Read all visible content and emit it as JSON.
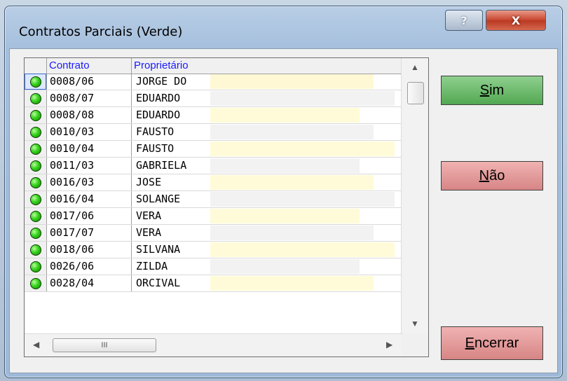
{
  "window": {
    "title": "Contratos Parciais (Verde)"
  },
  "titlebar": {
    "help_glyph": "?",
    "close_glyph": "X"
  },
  "grid": {
    "columns": [
      "",
      "Contrato",
      "Proprietário"
    ],
    "rows": [
      {
        "contrato": "0008/06",
        "proprietario": "JORGE DO",
        "highlight_color": "#fff8d4",
        "selected": true
      },
      {
        "contrato": "0008/07",
        "proprietario": "EDUARDO",
        "highlight_color": "#f2f2f2",
        "selected": false
      },
      {
        "contrato": "0008/08",
        "proprietario": "EDUARDO",
        "highlight_color": "#fffbd8",
        "selected": false
      },
      {
        "contrato": "0010/03",
        "proprietario": "FAUSTO",
        "highlight_color": "#f2f2f2",
        "selected": false
      },
      {
        "contrato": "0010/04",
        "proprietario": "FAUSTO",
        "highlight_color": "#fffbd8",
        "selected": false
      },
      {
        "contrato": "0011/03",
        "proprietario": "GABRIELA",
        "highlight_color": "#f2f2f2",
        "selected": false
      },
      {
        "contrato": "0016/03",
        "proprietario": "JOSE",
        "highlight_color": "#fffbd8",
        "selected": false
      },
      {
        "contrato": "0016/04",
        "proprietario": "SOLANGE",
        "highlight_color": "#f2f2f2",
        "selected": false
      },
      {
        "contrato": "0017/06",
        "proprietario": "VERA",
        "highlight_color": "#fffbd8",
        "selected": false
      },
      {
        "contrato": "0017/07",
        "proprietario": "VERA",
        "highlight_color": "#f2f2f2",
        "selected": false
      },
      {
        "contrato": "0018/06",
        "proprietario": "SILVANA",
        "highlight_color": "#fffbd8",
        "selected": false
      },
      {
        "contrato": "0026/06",
        "proprietario": "ZILDA",
        "highlight_color": "#f2f2f2",
        "selected": false
      },
      {
        "contrato": "0028/04",
        "proprietario": "ORCIVAL",
        "highlight_color": "#fffbd8",
        "selected": false
      }
    ],
    "status_icon": "green-led-icon",
    "hscroll_thumb": "III"
  },
  "buttons": {
    "sim_mnemonic": "S",
    "sim_rest": "im",
    "nao_mnemonic": "N",
    "nao_rest": "ão",
    "encerrar_mnemonic": "E",
    "encerrar_rest": "ncerrar"
  },
  "colors": {
    "sim": "#6abb6a",
    "nao": "#e59c9c",
    "encerrar": "#e59c9c",
    "header_text": "#1a1aff"
  }
}
